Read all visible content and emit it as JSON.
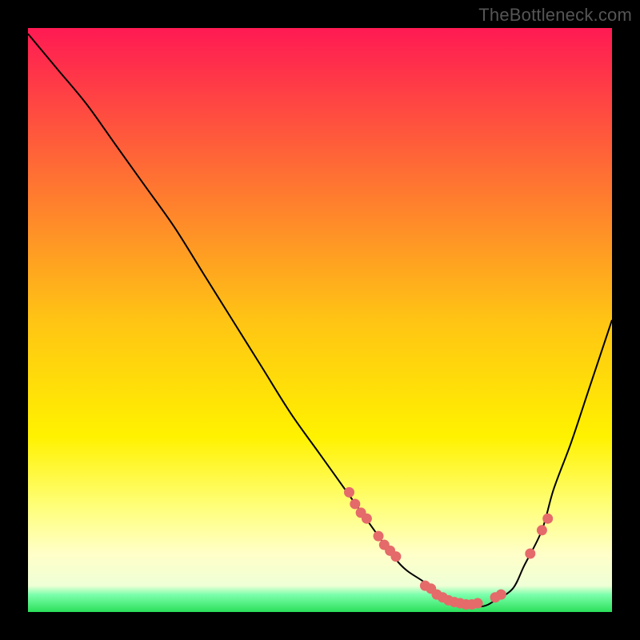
{
  "watermark": "TheBottleneck.com",
  "colors": {
    "marker": "#e56a6a",
    "curve": "#000000",
    "green_band": "#2be05a"
  },
  "gradient_stops": [
    {
      "offset": 0.0,
      "color": "#ff1a53"
    },
    {
      "offset": 0.5,
      "color": "#ffc414"
    },
    {
      "offset": 0.7,
      "color": "#fff200"
    },
    {
      "offset": 0.82,
      "color": "#ffff7a"
    },
    {
      "offset": 0.9,
      "color": "#ffffc8"
    },
    {
      "offset": 0.955,
      "color": "#efffd6"
    },
    {
      "offset": 0.97,
      "color": "#7dffad"
    },
    {
      "offset": 1.0,
      "color": "#2be05a"
    }
  ],
  "chart_data": {
    "type": "line",
    "title": "",
    "xlabel": "",
    "ylabel": "",
    "xlim": [
      0,
      100
    ],
    "ylim": [
      0,
      100
    ],
    "series": [
      {
        "name": "bottleneck-curve",
        "x": [
          0,
          5,
          10,
          15,
          20,
          25,
          30,
          35,
          40,
          45,
          50,
          55,
          60,
          63,
          65,
          68,
          70,
          73,
          75,
          78,
          80,
          83,
          85,
          88,
          90,
          93,
          96,
          100
        ],
        "values": [
          99,
          93,
          87,
          80,
          73,
          66,
          58,
          50,
          42,
          34,
          27,
          20,
          13,
          9,
          7,
          5,
          3,
          2,
          1,
          1,
          2,
          4,
          8,
          14,
          21,
          29,
          38,
          50
        ]
      }
    ],
    "markers": [
      {
        "x": 55,
        "y": 20.5
      },
      {
        "x": 56,
        "y": 18.5
      },
      {
        "x": 57,
        "y": 17.0
      },
      {
        "x": 58,
        "y": 16.0
      },
      {
        "x": 60,
        "y": 13.0
      },
      {
        "x": 61,
        "y": 11.5
      },
      {
        "x": 62,
        "y": 10.5
      },
      {
        "x": 63,
        "y": 9.5
      },
      {
        "x": 68,
        "y": 4.5
      },
      {
        "x": 69,
        "y": 4.0
      },
      {
        "x": 70,
        "y": 3.0
      },
      {
        "x": 71,
        "y": 2.5
      },
      {
        "x": 72,
        "y": 2.0
      },
      {
        "x": 73,
        "y": 1.7
      },
      {
        "x": 74,
        "y": 1.5
      },
      {
        "x": 75,
        "y": 1.3
      },
      {
        "x": 76,
        "y": 1.3
      },
      {
        "x": 77,
        "y": 1.5
      },
      {
        "x": 80,
        "y": 2.5
      },
      {
        "x": 81,
        "y": 3.0
      },
      {
        "x": 86,
        "y": 10.0
      },
      {
        "x": 88,
        "y": 14.0
      },
      {
        "x": 89,
        "y": 16.0
      }
    ]
  }
}
